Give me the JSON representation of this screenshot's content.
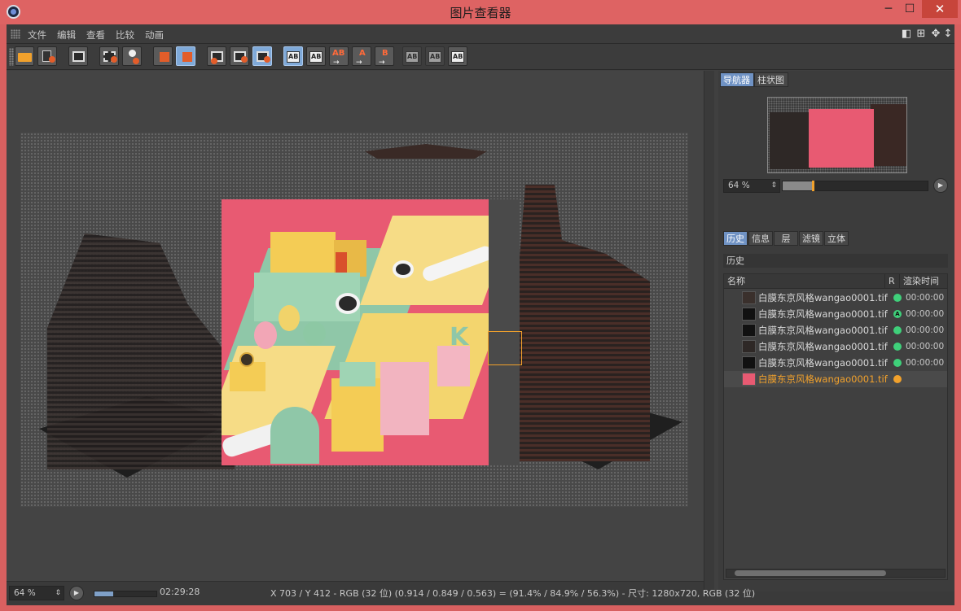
{
  "window": {
    "title": "图片查看器",
    "min": "─",
    "max": "☐",
    "close": "✕"
  },
  "menu": {
    "items": [
      "文件",
      "编辑",
      "查看",
      "比较",
      "动画"
    ]
  },
  "panel": {
    "tabs": [
      "导航器",
      "柱状图"
    ],
    "zoom": "64 %",
    "zoom_arrow": "⇕",
    "zoom_slider_level": 0.26,
    "sub_tabs": [
      "历史",
      "信息",
      "层",
      "滤镜",
      "立体"
    ],
    "section": "历史",
    "columns": {
      "name": "名称",
      "r": "R",
      "time": "渲染时间"
    },
    "history": [
      {
        "file": "白膜东京风格wangao0001.tif",
        "status": "green",
        "time": "00:00:00"
      },
      {
        "file": "白膜东京风格wangao0001.tif",
        "status": "a",
        "status_label": "A",
        "time": "00:00:00"
      },
      {
        "file": "白膜东京风格wangao0001.tif",
        "status": "green",
        "time": "00:00:00"
      },
      {
        "file": "白膜东京风格wangao0001.tif",
        "status": "green",
        "time": "00:00:00"
      },
      {
        "file": "白膜东京风格wangao0001.tif",
        "status": "green",
        "time": "00:00:00"
      },
      {
        "file": "白膜东京风格wangao0001.tif",
        "status": "orange",
        "time": ""
      }
    ]
  },
  "statusbar": {
    "zoom": "64 %",
    "zoom_arrow": "⇕",
    "time": "02:29:28",
    "progress_level": 0.3,
    "info": "X 703 / Y 412 - RGB (32 位) (0.914 / 0.849 / 0.563) = (91.4% / 84.9% / 56.3%) - 尺寸: 1280x720, RGB (32 位)"
  },
  "colors": {
    "titlebar": "#de6363",
    "accent": "#f1a12c",
    "active_tab": "#6f92c4",
    "status_green": "#3fd07a"
  }
}
